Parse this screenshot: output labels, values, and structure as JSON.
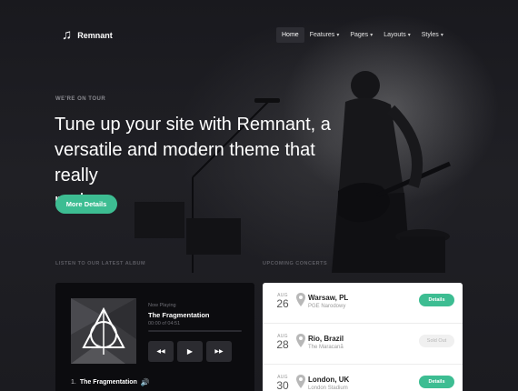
{
  "brand": {
    "name": "Remnant",
    "logo_icon": "music-note-icon"
  },
  "nav": {
    "items": [
      {
        "label": "Home",
        "active": true,
        "dropdown": false
      },
      {
        "label": "Features",
        "active": false,
        "dropdown": true
      },
      {
        "label": "Pages",
        "active": false,
        "dropdown": true
      },
      {
        "label": "Layouts",
        "active": false,
        "dropdown": true
      },
      {
        "label": "Styles",
        "active": false,
        "dropdown": true
      }
    ]
  },
  "hero": {
    "eyebrow": "WE'RE ON TOUR",
    "headline_lines": [
      "Tune up your site with Remnant, a",
      "versatile and modern theme that really",
      "rocks."
    ],
    "cta_label": "More Details"
  },
  "album": {
    "section_label": "LISTEN TO OUR LATEST ALBUM",
    "now_playing_label": "Now Playing",
    "track_title": "The Fragmentation",
    "time": "00:00 of 04:51",
    "progress": 0,
    "controls": [
      "previous-icon",
      "play-icon",
      "next-icon"
    ],
    "tracks": [
      {
        "number": "1.",
        "title": "The Fragmentation",
        "playing": true
      }
    ]
  },
  "concerts": {
    "section_label": "UPCOMING CONCERTS",
    "items": [
      {
        "month": "AUG",
        "day": "26",
        "city": "Warsaw, PL",
        "venue": "PGE Narodowy",
        "action": "Details",
        "sold_out": false
      },
      {
        "month": "AUG",
        "day": "28",
        "city": "Rio, Brazil",
        "venue": "The Maracanã",
        "action": "Sold Out",
        "sold_out": true
      },
      {
        "month": "AUG",
        "day": "30",
        "city": "London, UK",
        "venue": "London Stadium",
        "action": "Details",
        "sold_out": false
      }
    ]
  },
  "colors": {
    "accent": "#3dbd92",
    "background": "#1a1a1f",
    "panel_dark": "#0c0c0f",
    "panel_light": "#ffffff"
  }
}
